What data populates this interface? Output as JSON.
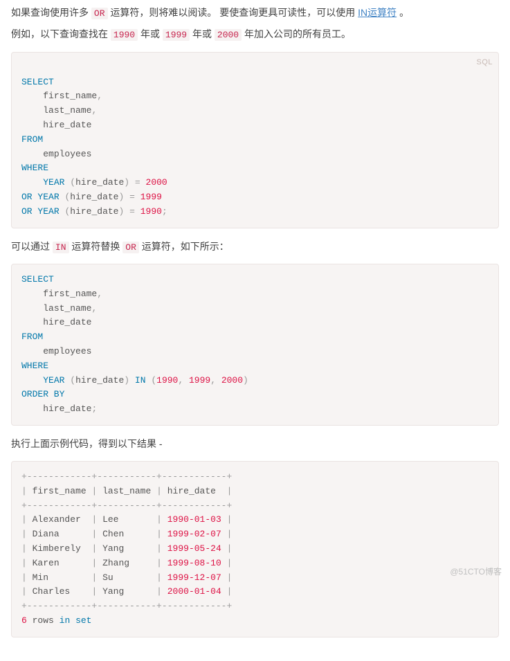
{
  "para1": {
    "t1": "如果查询使用许多 ",
    "code_or": "OR",
    "t2": " 运算符，则将难以阅读。 要使查询更具可读性，可以使用 ",
    "link_in": "IN运算符",
    "t3": " 。"
  },
  "para2": {
    "t1": "例如，以下查询查找在 ",
    "y1": "1990",
    "m1": " 年或 ",
    "y2": "1999",
    "m2": " 年或 ",
    "y3": "2000",
    "t2": " 年加入公司的所有员工。"
  },
  "code1": {
    "lang": "SQL",
    "k_select": "SELECT",
    "first_name": "first_name",
    "last_name": "last_name",
    "hire_date": "hire_date",
    "k_from": "FROM",
    "employees": "employees",
    "k_where": "WHERE",
    "fn_year": "YEAR",
    "k_or": "OR",
    "v2000": "2000",
    "v1999": "1999",
    "v1990": "1990"
  },
  "para3": {
    "t1": "可以通过 ",
    "code_in": "IN",
    "t2": " 运算符替换 ",
    "code_or": "OR",
    "t3": " 运算符，如下所示："
  },
  "code2": {
    "k_select": "SELECT",
    "first_name": "first_name",
    "last_name": "last_name",
    "hire_date": "hire_date",
    "k_from": "FROM",
    "employees": "employees",
    "k_where": "WHERE",
    "fn_year": "YEAR",
    "k_in": "IN",
    "v1990": "1990",
    "v1999": "1999",
    "v2000": "2000",
    "k_order": "ORDER BY"
  },
  "para4": "执行上面示例代码，得到以下结果 -",
  "result": {
    "border": "+------------+-----------+------------+",
    "h1": "first_name",
    "h2": "last_name",
    "h3": "hire_date",
    "rows": [
      {
        "fn": "Alexander",
        "ln": "Lee",
        "hd": "1990-01-03"
      },
      {
        "fn": "Diana",
        "ln": "Chen",
        "hd": "1999-02-07"
      },
      {
        "fn": "Kimberely",
        "ln": "Yang",
        "hd": "1999-05-24"
      },
      {
        "fn": "Karen",
        "ln": "Zhang",
        "hd": "1999-08-10"
      },
      {
        "fn": "Min",
        "ln": "Su",
        "hd": "1999-12-07"
      },
      {
        "fn": "Charles",
        "ln": "Yang",
        "hd": "2000-01-04"
      }
    ],
    "foot_n": "6",
    "foot_rows": "rows",
    "foot_in": "in",
    "foot_set": "set"
  },
  "watermark": "@51CTO博客"
}
